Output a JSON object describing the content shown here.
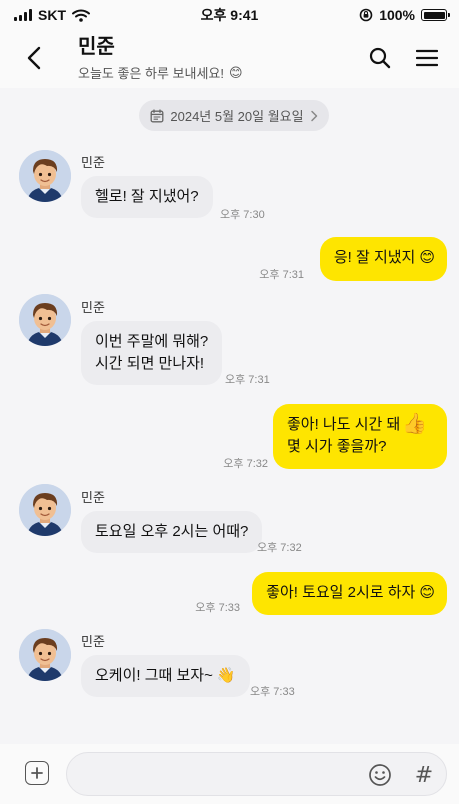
{
  "status_bar": {
    "carrier": "SKT",
    "time": "오후 9:41",
    "battery_percent": "100%",
    "battery_level": 1.0
  },
  "header": {
    "title": "민준",
    "subtitle": "오늘도 좋은 하루 보내세요!",
    "subtitle_emoji": "😊"
  },
  "date_pill": {
    "label": "2024년 5월 20일 월요일"
  },
  "messages": [
    {
      "side": "in",
      "sender": "민준",
      "text": "헬로! 잘 지냈어?",
      "time": "오후 7:30"
    },
    {
      "side": "out",
      "text": "응! 잘 지냈지",
      "emoji": "😊",
      "time": "오후 7:31"
    },
    {
      "side": "in",
      "sender": "민준",
      "text": "이번 주말에 뭐해?\n시간 되면 만나자!",
      "time": "오후 7:31"
    },
    {
      "side": "out",
      "text": "좋아! 나도 시간 돼\n몇 시가 좋을까?",
      "emoji": "👍",
      "time": "오후 7:32"
    },
    {
      "side": "in",
      "sender": "민준",
      "text": "토요일 오후 2시는 어때?",
      "time": "오후 7:32"
    },
    {
      "side": "out",
      "text": "좋아! 토요일 2시로 하자",
      "emoji": "😊",
      "time": "오후 7:33"
    },
    {
      "side": "in",
      "sender": "민준",
      "text": "오케이! 그때 보자~",
      "emoji": "👋",
      "time": "오후 7:33"
    }
  ],
  "input_bar": {
    "placeholder": "",
    "emoji_icon": "smile-icon",
    "hash_label": "#"
  },
  "colors": {
    "outgoing_bubble": "#fee500",
    "incoming_bubble": "#ececef",
    "background": "#f5f5f7"
  }
}
